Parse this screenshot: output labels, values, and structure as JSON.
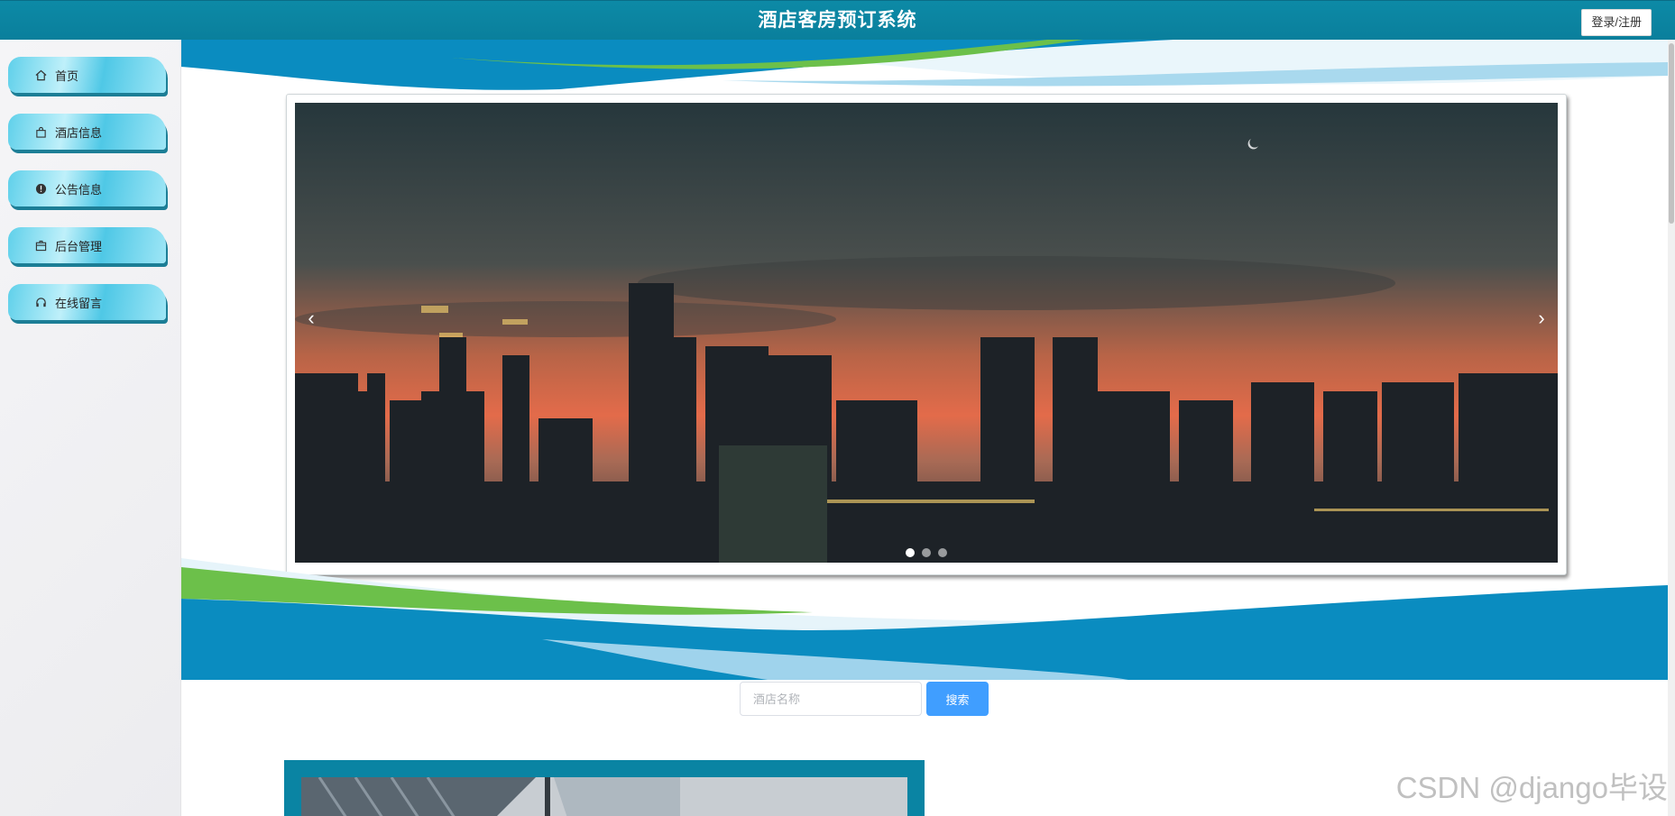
{
  "header": {
    "title": "酒店客房预订系统",
    "login_label": "登录/注册"
  },
  "sidebar": {
    "items": [
      {
        "label": "首页",
        "icon": "home-icon"
      },
      {
        "label": "酒店信息",
        "icon": "bag-icon"
      },
      {
        "label": "公告信息",
        "icon": "info-icon"
      },
      {
        "label": "后台管理",
        "icon": "box-icon"
      },
      {
        "label": "在线留言",
        "icon": "headset-icon"
      }
    ]
  },
  "carousel": {
    "prev_icon": "chevron-left-icon",
    "next_icon": "chevron-right-icon",
    "prev_symbol": "‹",
    "next_symbol": "›",
    "slide_count": 3,
    "active_index": 0
  },
  "search": {
    "placeholder": "酒店名称",
    "value": "",
    "button_label": "搜索"
  },
  "watermark": "CSDN @django毕设",
  "colors": {
    "header": "#0a84a3",
    "nav_gradient": "#5fd0ea",
    "search_button": "#409eff",
    "wave_green": "#6cc04a",
    "wave_blue": "#0a8cc0"
  }
}
